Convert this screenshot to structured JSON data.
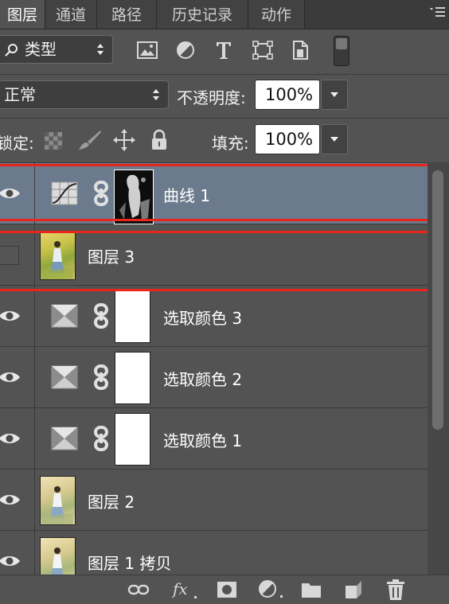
{
  "tabs": [
    {
      "label": "图层",
      "active": true
    },
    {
      "label": "通道",
      "active": false
    },
    {
      "label": "路径",
      "active": false
    },
    {
      "label": "历史记录",
      "active": false
    },
    {
      "label": "动作",
      "active": false
    }
  ],
  "filter": {
    "label": "类型"
  },
  "blend": {
    "mode": "正常",
    "opacity_label": "不透明度:",
    "opacity_value": "100%"
  },
  "lock": {
    "label": "锁定:",
    "fill_label": "填充:",
    "fill_value": "100%"
  },
  "layers": [
    {
      "name": "曲线 1",
      "visible": true,
      "selected": true,
      "highlighted": true,
      "type": "curves-adjustment"
    },
    {
      "name": "图层 3",
      "visible": false,
      "selected": false,
      "highlighted": true,
      "type": "pixel"
    },
    {
      "name": "选取颜色 3",
      "visible": true,
      "selected": false,
      "type": "selective-color"
    },
    {
      "name": "选取颜色 2",
      "visible": true,
      "selected": false,
      "type": "selective-color"
    },
    {
      "name": "选取颜色 1",
      "visible": true,
      "selected": false,
      "type": "selective-color"
    },
    {
      "name": "图层 2",
      "visible": true,
      "selected": false,
      "type": "pixel"
    },
    {
      "name": "图层 1 拷贝",
      "visible": true,
      "selected": false,
      "type": "pixel"
    }
  ],
  "colors": {
    "panel": "#535353",
    "selected_row": "#6b7a8d",
    "highlight": "#e8261c"
  }
}
